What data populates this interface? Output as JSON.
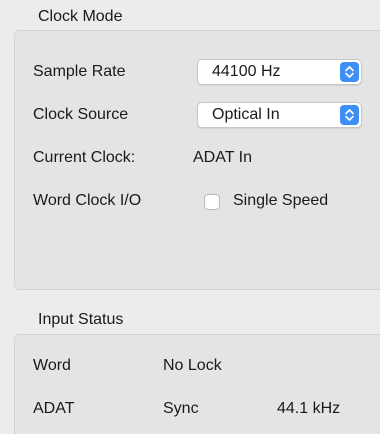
{
  "clock_mode": {
    "title": "Clock Mode",
    "sample_rate": {
      "label": "Sample Rate",
      "value": "44100 Hz"
    },
    "clock_source": {
      "label": "Clock Source",
      "value": "Optical In"
    },
    "current_clock": {
      "label": "Current Clock:",
      "value": "ADAT In"
    },
    "word_clock_io": {
      "label": "Word Clock I/O",
      "checkbox_label": "Single Speed",
      "checked": false
    }
  },
  "input_status": {
    "title": "Input Status",
    "rows": [
      {
        "input": "Word",
        "state": "No Lock",
        "rate": ""
      },
      {
        "input": "ADAT",
        "state": "Sync",
        "rate": "44.1 kHz"
      }
    ]
  },
  "colors": {
    "accent": "#3d8ff5",
    "panel": "#e4e4e4",
    "window": "#ececec"
  },
  "icons": {
    "popup_stepper": "up-down-chevron-icon"
  }
}
